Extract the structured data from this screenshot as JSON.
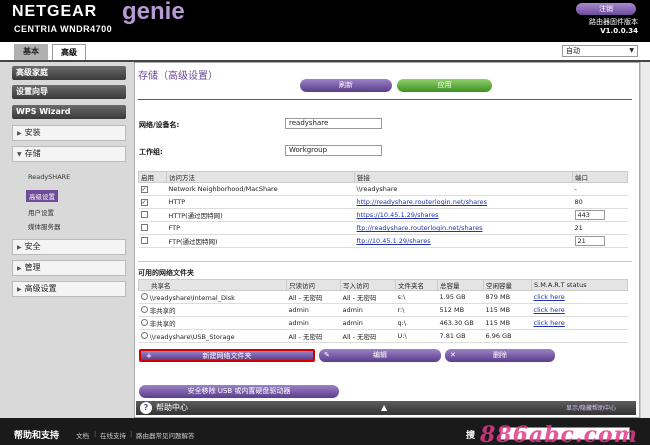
{
  "header": {
    "brand": "NETGEAR",
    "product": "genie",
    "model": "CENTRIA   WNDR4700",
    "logout_label": "注销",
    "firmware_label": "路由器固件版本",
    "firmware_version": "V1.0.0.34"
  },
  "tabs": {
    "basic": "基本",
    "advanced": "高级"
  },
  "language": {
    "value": "自动"
  },
  "sidebar": {
    "buttons": [
      "高级家庭",
      "设置向导",
      "WPS Wizard"
    ],
    "sections": [
      "安装",
      "存储",
      "安全",
      "管理",
      "高级设置"
    ],
    "storage_sub": [
      "ReadySHARE",
      "高级设置",
      "用户设置",
      "媒体服务器"
    ]
  },
  "page": {
    "title": "存储（高级设置）",
    "refresh_label": "刷新",
    "apply_label": "应用",
    "network_device_label": "网络/设备名:",
    "network_device_value": "readyshare",
    "workgroup_label": "工作组:",
    "workgroup_value": "Workgroup"
  },
  "access_table": {
    "headers": [
      "启用",
      "访问方法",
      "链接",
      "端口"
    ],
    "rows": [
      {
        "enabled": true,
        "method": "Network Neighborhood/MacShare",
        "link": "\\\\readyshare",
        "link_is_url": false,
        "port": "-",
        "port_editable": false
      },
      {
        "enabled": true,
        "method": "HTTP",
        "link": "http://readyshare.routerlogin.net/shares",
        "link_is_url": true,
        "port": "80",
        "port_editable": false
      },
      {
        "enabled": false,
        "method": "HTTP(通过因特网)",
        "link": "https://10.45.1.29/shares",
        "link_is_url": true,
        "port": "443",
        "port_editable": true
      },
      {
        "enabled": false,
        "method": "FTP",
        "link": "ftp://readyshare.routerlogin.net/shares",
        "link_is_url": true,
        "port": "21",
        "port_editable": false
      },
      {
        "enabled": false,
        "method": "FTP(通过因特网)",
        "link": "ftp://10.45.1.29/shares",
        "link_is_url": true,
        "port": "21",
        "port_editable": true
      }
    ]
  },
  "available_folders": {
    "title": "可用的网络文件夹",
    "headers": [
      "共享名",
      "只读访问",
      "写入访问",
      "文件夹名",
      "总容量",
      "空闲容量",
      "S.M.A.R.T status"
    ],
    "rows": [
      {
        "share": "\\\\readyshare\\Internal_Disk",
        "read": "All - 无密码",
        "write": "All - 无密码",
        "folder": "s:\\",
        "total": "1.95 GB",
        "free": "879 MB",
        "smart": "click here"
      },
      {
        "share": "非共享的",
        "read": "admin",
        "write": "admin",
        "folder": "r:\\",
        "total": "512 MB",
        "free": "115 MB",
        "smart": "click here"
      },
      {
        "share": "非共享的",
        "read": "admin",
        "write": "admin",
        "folder": "q:\\",
        "total": "463.30 GB",
        "free": "115 MB",
        "smart": "click here"
      },
      {
        "share": "\\\\readyshare\\USB_Storage",
        "read": "All - 无密码",
        "write": "All - 无密码",
        "folder": "U:\\",
        "total": "7.81 GB",
        "free": "6.96 GB",
        "smart": ""
      }
    ],
    "new_folder_label": "新建网络文件夹",
    "edit_label": "编辑",
    "delete_label": "删除",
    "safe_remove_label": "安全移除 USB 或内置硬盘驱动器"
  },
  "help": {
    "title": "帮助中心",
    "show_hide": "显示/隐藏帮助中心"
  },
  "footer": {
    "title": "帮助和支持",
    "links": [
      "文档",
      "在线支持",
      "路由器常见问题解答"
    ],
    "search_label": "搜"
  },
  "watermark": "886abc.com"
}
